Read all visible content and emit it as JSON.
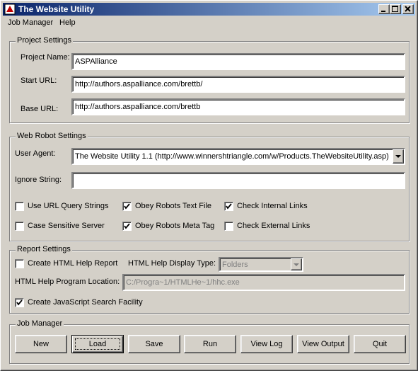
{
  "window": {
    "title": "The Website Utility"
  },
  "menu": [
    "Job Manager",
    "Help"
  ],
  "project": {
    "title": "Project Settings",
    "name_label": "Project Name:",
    "name_value": "ASPAlliance",
    "start_label": "Start URL:",
    "start_value": "http://authors.aspalliance.com/brettb/",
    "base_label": "Base URL:",
    "base_value": "http://authors.aspalliance.com/brettb"
  },
  "robot": {
    "title": "Web Robot Settings",
    "agent_label": "User Agent:",
    "agent_value": "The Website Utility 1.1 (http://www.winnershtriangle.com/w/Products.TheWebsiteUtility.asp)",
    "ignore_label": "Ignore String:",
    "ignore_value": "",
    "checks": [
      {
        "label": "Use URL Query Strings",
        "checked": false
      },
      {
        "label": "Obey Robots Text File",
        "checked": true
      },
      {
        "label": "Check Internal Links",
        "checked": true
      },
      {
        "label": "Case Sensitive Server",
        "checked": false
      },
      {
        "label": "Obey Robots Meta Tag",
        "checked": true
      },
      {
        "label": "Check External Links",
        "checked": false
      }
    ]
  },
  "report": {
    "title": "Report Settings",
    "create_html_help": {
      "label": "Create HTML Help Report",
      "checked": false
    },
    "display_type_label": "HTML Help Display Type:",
    "display_type_value": "Folders",
    "program_label": "HTML Help Program Location:",
    "program_value": "C:/Progra~1/HTMLHe~1/hhc.exe",
    "create_js_search": {
      "label": "Create JavaScript Search Facility",
      "checked": true
    }
  },
  "jobs": {
    "title": "Job Manager",
    "buttons": [
      "New",
      "Load",
      "Save",
      "Run",
      "View Log",
      "View Output",
      "Quit"
    ]
  }
}
